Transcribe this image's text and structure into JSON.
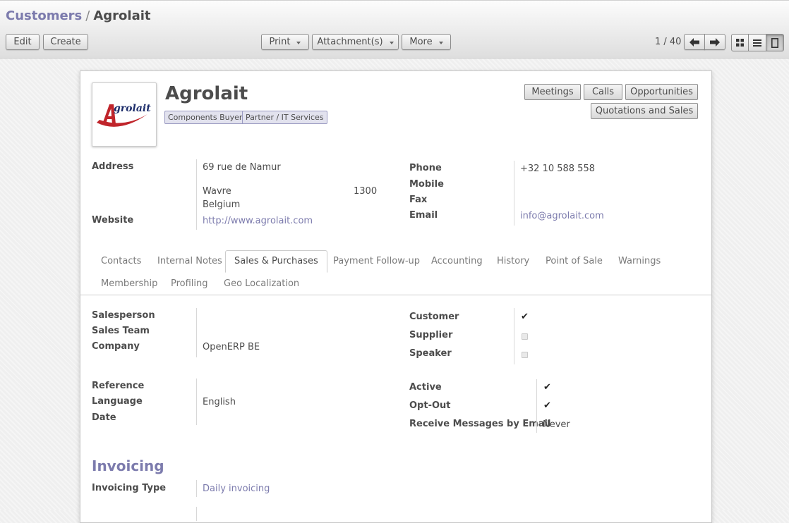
{
  "breadcrumb": {
    "parent": "Customers",
    "separator": "/",
    "current": "Agrolait"
  },
  "toolbar": {
    "edit": "Edit",
    "create": "Create",
    "print": "Print",
    "attachments": "Attachment(s)",
    "more": "More",
    "pager": "1 / 40"
  },
  "view_switcher": {
    "active": "form",
    "icons": [
      "kanban-icon",
      "list-icon",
      "form-icon"
    ]
  },
  "partner": {
    "name": "Agrolait",
    "logo_text": "Agrolait",
    "tags": [
      "Components Buyer",
      "Partner / IT Services"
    ],
    "smart_buttons": [
      "Meetings",
      "Calls",
      "Opportunities",
      "Quotations and Sales"
    ]
  },
  "address_block": {
    "address_label": "Address",
    "street": "69 rue de Namur",
    "city": "Wavre",
    "zip": "1300",
    "country": "Belgium",
    "website_label": "Website",
    "website": "http://www.agrolait.com"
  },
  "contact_block": {
    "phone_label": "Phone",
    "phone": "+32 10 588 558",
    "mobile_label": "Mobile",
    "fax_label": "Fax",
    "email_label": "Email",
    "email": "info@agrolait.com"
  },
  "tabs": {
    "row1": [
      "Contacts",
      "Internal Notes",
      "Sales & Purchases",
      "Payment Follow-up",
      "Accounting",
      "History",
      "Point of Sale",
      "Warnings"
    ],
    "row2": [
      "Membership",
      "Profiling",
      "Geo Localization"
    ],
    "active": "Sales & Purchases"
  },
  "sales": {
    "salesperson_label": "Salesperson",
    "sales_team_label": "Sales Team",
    "company_label": "Company",
    "company": "OpenERP BE",
    "customer_label": "Customer",
    "customer": true,
    "supplier_label": "Supplier",
    "supplier": false,
    "speaker_label": "Speaker",
    "speaker": false,
    "reference_label": "Reference",
    "language_label": "Language",
    "language": "English",
    "date_label": "Date",
    "active_label": "Active",
    "active": true,
    "optout_label": "Opt-Out",
    "optout": true,
    "receive_label": "Receive Messages by Email",
    "receive": "Never"
  },
  "invoicing": {
    "title": "Invoicing",
    "type_label": "Invoicing Type",
    "type": "Daily invoicing"
  },
  "colors": {
    "accent": "#7c7bad",
    "text": "#4c4c4c",
    "logo_red": "#c0252b",
    "logo_blue": "#1d2d6b"
  }
}
